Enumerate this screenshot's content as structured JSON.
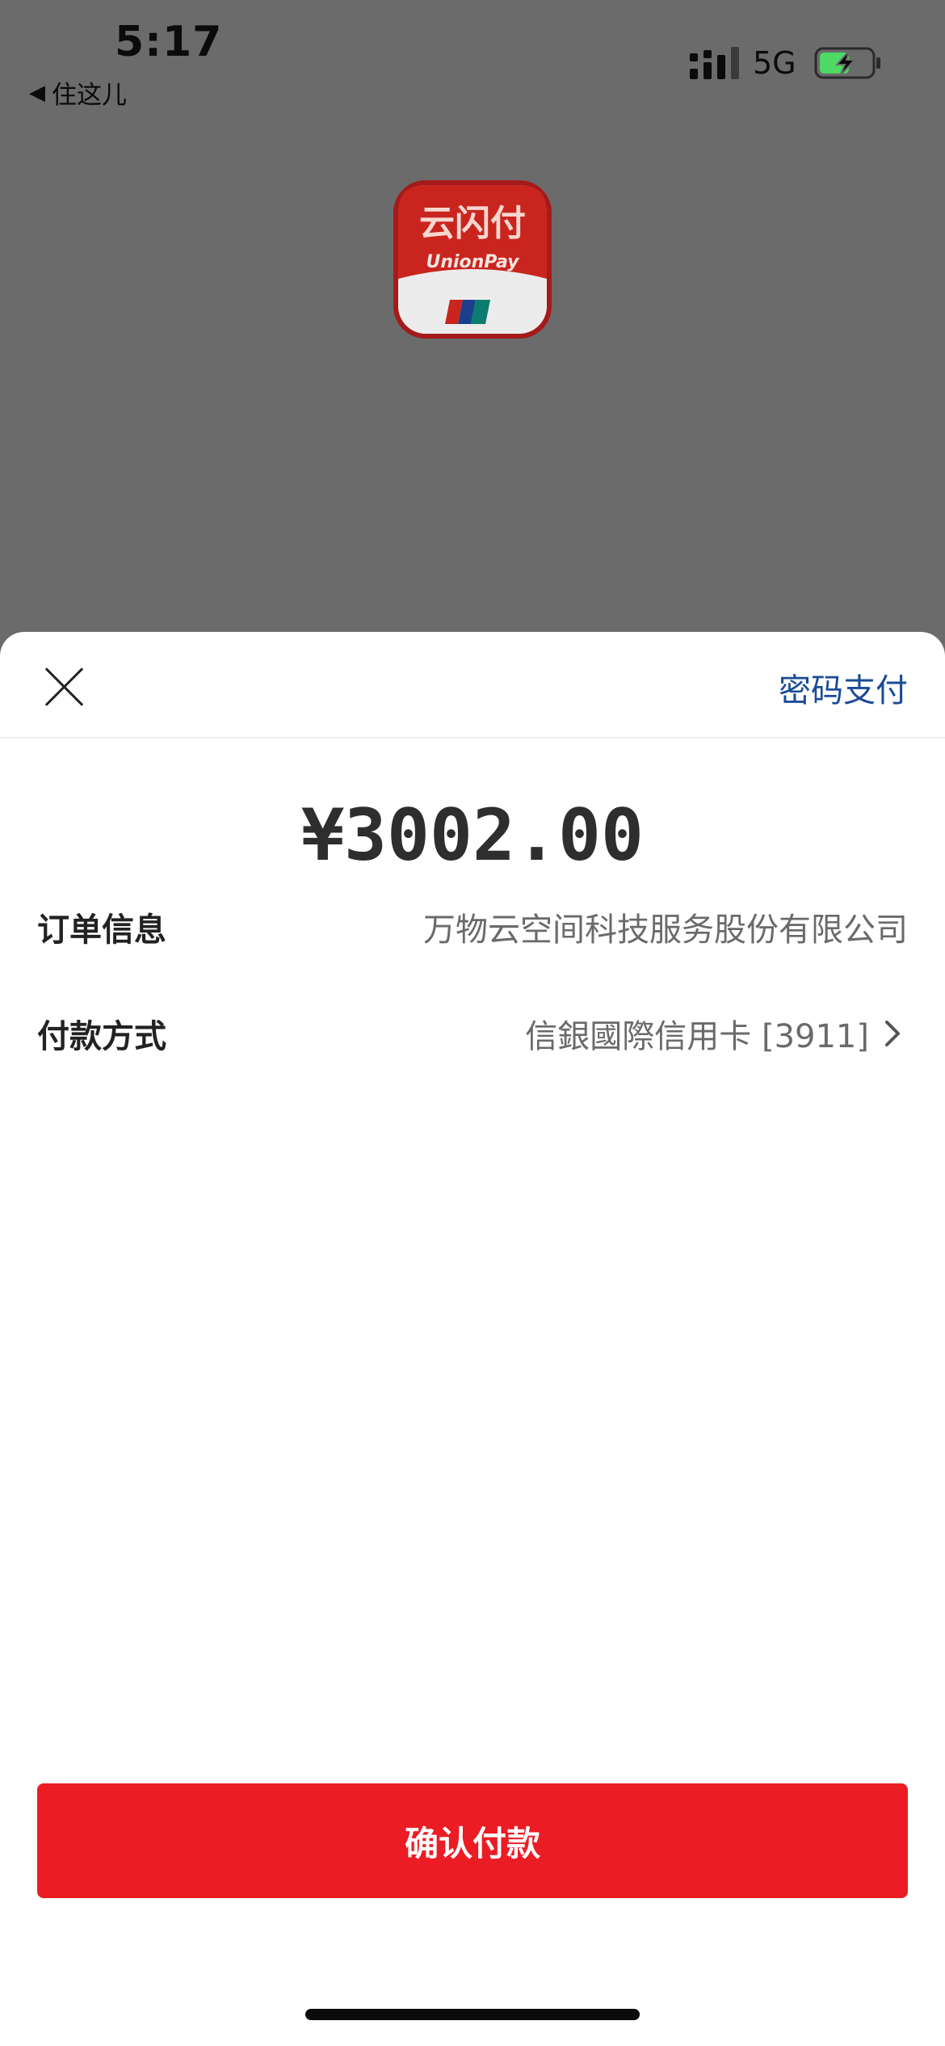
{
  "status_bar": {
    "time": "5:17",
    "back_app": "住这儿",
    "network": "5G",
    "icons": [
      "back-triangle-icon",
      "signal-icon",
      "battery-charging-icon"
    ]
  },
  "app_logo": {
    "name_cn": "云闪付",
    "name_en": "UnionPay"
  },
  "sheet": {
    "password_pay_label": "密码支付",
    "amount": "¥3002.00",
    "order_label": "订单信息",
    "order_value": "万物云空间科技服务股份有限公司",
    "payment_label": "付款方式",
    "payment_value": "信銀國際信用卡 [3911]",
    "confirm_label": "确认付款"
  },
  "colors": {
    "overlay": "#6b6b6b",
    "accent_red": "#ec1c24",
    "link_blue": "#1a4b96",
    "battery_green": "#4cd964"
  }
}
